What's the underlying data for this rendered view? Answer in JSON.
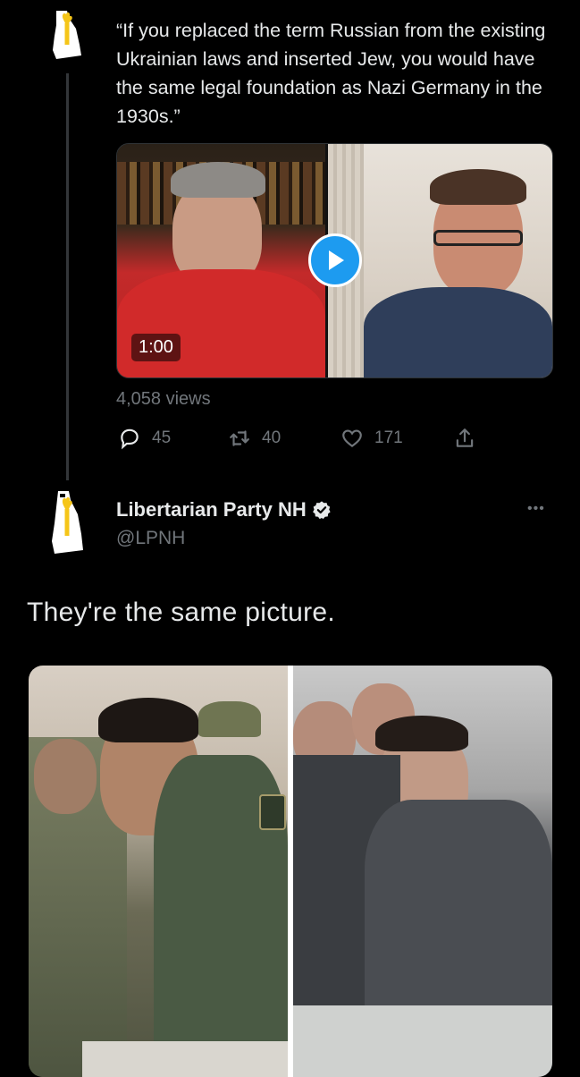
{
  "quoted_tweet": {
    "text": "“If you replaced the term Russian from the existing Ukrainian laws and inserted Jew, you would have the same legal foundation as Nazi Germany in the 1930s.”",
    "video_duration": "1:00",
    "views": "4,058 views",
    "actions": {
      "replies": "45",
      "retweets": "40",
      "likes": "171"
    }
  },
  "reply_tweet": {
    "author_name": "Libertarian Party NH",
    "handle": "@LPNH",
    "more_label": "•••",
    "text": "They're the same picture."
  },
  "colors": {
    "background": "#000000",
    "text_primary": "#e7e9ea",
    "text_secondary": "#71767b",
    "accent": "#1d9bf0",
    "torch_yellow": "#f5c518"
  },
  "icons": {
    "avatar": "nh-torch-logo",
    "verified": "verified-badge-icon",
    "play": "play-icon",
    "reply": "reply-icon",
    "retweet": "retweet-icon",
    "like": "heart-icon",
    "share": "share-icon"
  }
}
